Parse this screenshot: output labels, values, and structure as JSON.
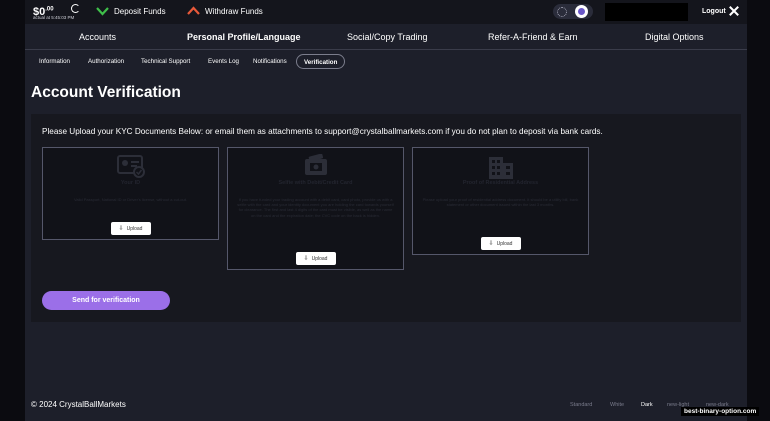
{
  "header": {
    "balance_amount": "$0",
    "balance_cents": ".00",
    "balance_time": "actual at 5:45:03 PM",
    "deposit_label": "Deposit Funds",
    "withdraw_label": "Withdraw Funds",
    "logout_label": "Logout",
    "colors": {
      "deposit": "#3fbf4a",
      "withdraw": "#e8593a",
      "accent": "#9b6fe8"
    }
  },
  "main_nav": [
    "Accounts",
    "Personal Profile/Language",
    "Social/Copy Trading",
    "Refer-A-Friend & Earn",
    "Digital Options"
  ],
  "main_nav_active": "Personal Profile/Language",
  "sub_nav": [
    "Information",
    "Authorization",
    "Technical Support",
    "Events Log",
    "Notifications",
    "Verification"
  ],
  "sub_nav_active": "Verification",
  "page_title": "Account Verification",
  "note": "Please Upload your KYC Documents Below: or email them as attachments to support@crystalballmarkets.com if you do not plan to deposit via bank cards.",
  "cards": [
    {
      "icon": "id-card-icon",
      "title": "Your ID",
      "description": "Valid Passport, National ID or Driver's license, without a cut-out.",
      "button": "Upload"
    },
    {
      "icon": "selfie-card-icon",
      "title": "Selfie with Debit/Credit Card",
      "description": "If you have funded your trading account with a debit card, card photo, provide us with a selfie with the card and your identity document you are holding the card towards yourself for clearance. The first and last 4 digits of the card must be visible, as well as the name on the card and the expiration date; the CVC code on the back is hidden.",
      "button": "Upload"
    },
    {
      "icon": "building-icon",
      "title": "Proof of Residential Address",
      "description": "Please upload your proof of residential address document. It should be a utility bill, bank statement or other document issued within the last 3 months.",
      "button": "Upload"
    }
  ],
  "send_button": "Send for verification",
  "footer": {
    "copyright": "© 2024 CrystalBallMarkets",
    "themes": [
      "Standard",
      "White",
      "Dark",
      "new-light",
      "new-dark"
    ],
    "theme_current": "Dark"
  },
  "watermark": "best-binary-option.com"
}
